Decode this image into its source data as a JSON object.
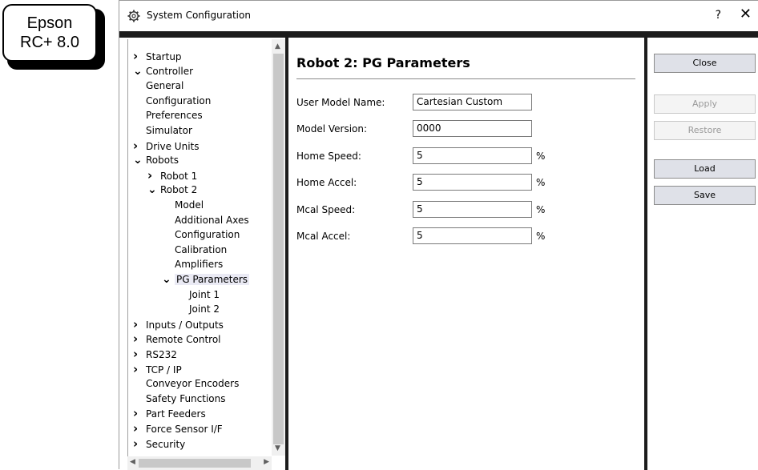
{
  "badge": {
    "line1": "Epson",
    "line2": "RC+ 8.0"
  },
  "window": {
    "title": "System Configuration",
    "title_icon": "gear-icon",
    "help_label": "?",
    "close_label": "✕"
  },
  "tree": [
    {
      "label": "Startup",
      "indent": 0,
      "arrow": "right"
    },
    {
      "label": "Controller",
      "indent": 0,
      "arrow": "down"
    },
    {
      "label": "General",
      "indent": 1,
      "arrow": ""
    },
    {
      "label": "Configuration",
      "indent": 1,
      "arrow": ""
    },
    {
      "label": "Preferences",
      "indent": 1,
      "arrow": ""
    },
    {
      "label": "Simulator",
      "indent": 1,
      "arrow": ""
    },
    {
      "label": "Drive Units",
      "indent": 1,
      "arrow": "right"
    },
    {
      "label": "Robots",
      "indent": 1,
      "arrow": "down"
    },
    {
      "label": "Robot 1",
      "indent": 2,
      "arrow": "right"
    },
    {
      "label": "Robot 2",
      "indent": 2,
      "arrow": "down"
    },
    {
      "label": "Model",
      "indent": 3,
      "arrow": ""
    },
    {
      "label": "Additional Axes",
      "indent": 3,
      "arrow": ""
    },
    {
      "label": "Configuration",
      "indent": 3,
      "arrow": ""
    },
    {
      "label": "Calibration",
      "indent": 3,
      "arrow": ""
    },
    {
      "label": "Amplifiers",
      "indent": 3,
      "arrow": ""
    },
    {
      "label": "PG Parameters",
      "indent": 3,
      "arrow": "down",
      "selected": true
    },
    {
      "label": "Joint 1",
      "indent": 4,
      "arrow": ""
    },
    {
      "label": "Joint 2",
      "indent": 4,
      "arrow": ""
    },
    {
      "label": "Inputs / Outputs",
      "indent": 1,
      "arrow": "right"
    },
    {
      "label": "Remote Control",
      "indent": 1,
      "arrow": "right"
    },
    {
      "label": "RS232",
      "indent": 1,
      "arrow": "right"
    },
    {
      "label": "TCP / IP",
      "indent": 1,
      "arrow": "right"
    },
    {
      "label": "Conveyor Encoders",
      "indent": 1,
      "arrow": ""
    },
    {
      "label": "Safety Functions",
      "indent": 1,
      "arrow": ""
    },
    {
      "label": "Part Feeders",
      "indent": 1,
      "arrow": "right"
    },
    {
      "label": "Force Sensor I/F",
      "indent": 1,
      "arrow": "right"
    },
    {
      "label": "Security",
      "indent": 0,
      "arrow": "right"
    }
  ],
  "main": {
    "heading": "Robot 2: PG Parameters",
    "fields": [
      {
        "label": "User Model Name:",
        "value": "Cartesian Custom",
        "unit": ""
      },
      {
        "label": "Model Version:",
        "value": "0000",
        "unit": ""
      },
      {
        "label": "Home Speed:",
        "value": "5",
        "unit": "%"
      },
      {
        "label": "Home Accel:",
        "value": "5",
        "unit": "%"
      },
      {
        "label": "Mcal Speed:",
        "value": "5",
        "unit": "%"
      },
      {
        "label": "Mcal Accel:",
        "value": "5",
        "unit": "%"
      }
    ]
  },
  "buttons": {
    "close": "Close",
    "apply": "Apply",
    "restore": "Restore",
    "load": "Load",
    "save": "Save"
  }
}
